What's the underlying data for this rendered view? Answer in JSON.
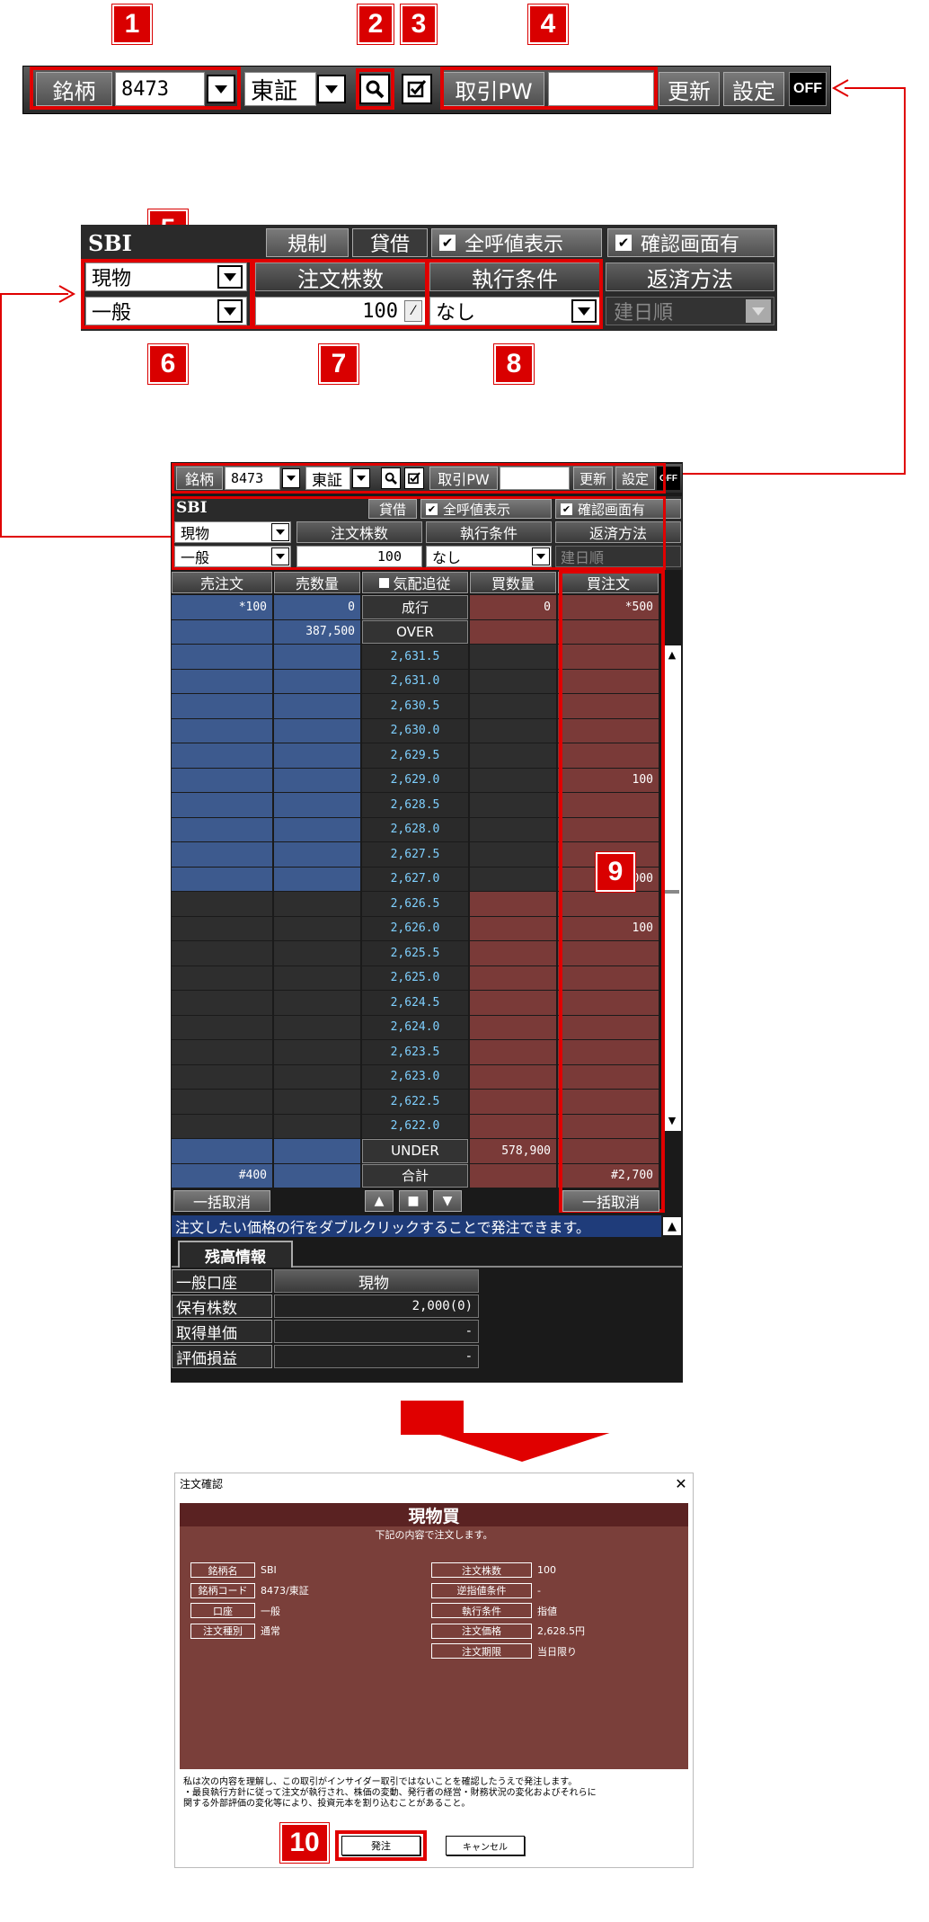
{
  "badges": [
    "1",
    "2",
    "3",
    "4",
    "5",
    "6",
    "7",
    "8",
    "9",
    "10"
  ],
  "toolbar": {
    "symbol_label": "銘柄",
    "symbol_value": "8473",
    "market_value": "東証",
    "search_icon": "search-icon",
    "check_icon": "checkbox-icon",
    "pw_label": "取引PW",
    "update_label": "更新",
    "settings_label": "設定",
    "off_label": "OFF"
  },
  "order_panel": {
    "name": "SBI",
    "rule_label": "規制",
    "lending_label": "貸借",
    "all_quotes_label": "全呼値表示",
    "confirm_label": "確認画面有",
    "account_type": "現物",
    "qty_header": "注文株数",
    "exec_header": "執行条件",
    "repay_header": "返済方法",
    "margin_type": "一般",
    "qty_value": "100",
    "exec_value": "なし",
    "repay_value": "建日順"
  },
  "board": {
    "headers": [
      "売注文",
      "売数量",
      "気配追従",
      "買数量",
      "買注文"
    ],
    "market_row": {
      "sell_order": "*100",
      "sell_qty": "0",
      "price": "成行",
      "buy_qty": "0",
      "buy_order": "*500"
    },
    "over_row": {
      "sell_qty": "387,500",
      "price": "OVER"
    },
    "rows": [
      {
        "price": "2,631.5",
        "buy_order": ""
      },
      {
        "price": "2,631.0",
        "buy_order": ""
      },
      {
        "price": "2,630.5",
        "buy_order": ""
      },
      {
        "price": "2,630.0",
        "buy_order": ""
      },
      {
        "price": "2,629.5",
        "buy_order": ""
      },
      {
        "price": "2,629.0",
        "buy_order": "100"
      },
      {
        "price": "2,628.5",
        "buy_order": ""
      },
      {
        "price": "2,628.0",
        "buy_order": ""
      },
      {
        "price": "2,627.5",
        "buy_order": ""
      },
      {
        "price": "2,627.0",
        "buy_order": "000"
      },
      {
        "price": "2,626.5",
        "buy_order": ""
      },
      {
        "price": "2,626.0",
        "buy_order": "100"
      },
      {
        "price": "2,625.5",
        "buy_order": ""
      },
      {
        "price": "2,625.0",
        "buy_order": ""
      },
      {
        "price": "2,624.5",
        "buy_order": ""
      },
      {
        "price": "2,624.0",
        "buy_order": ""
      },
      {
        "price": "2,623.5",
        "buy_order": ""
      },
      {
        "price": "2,623.0",
        "buy_order": ""
      },
      {
        "price": "2,622.5",
        "buy_order": ""
      },
      {
        "price": "2,622.0",
        "buy_order": ""
      }
    ],
    "under_row": {
      "price": "UNDER",
      "buy_qty": "578,900"
    },
    "total_row": {
      "sell_order": "#400",
      "price": "合計",
      "buy_order": "#2,700"
    },
    "cancel_all_label": "一括取消",
    "hint_text": "注文したい価格の行をダブルクリックすることで発注できます。"
  },
  "holdings": {
    "tab_label": "残高情報",
    "rows": [
      {
        "label": "一般口座",
        "value": "現物"
      },
      {
        "label": "保有株数",
        "value": "2,000(0)"
      },
      {
        "label": "取得単価",
        "value": "-"
      },
      {
        "label": "評価損益",
        "value": "-"
      }
    ]
  },
  "dialog": {
    "window_title": "注文確認",
    "close_icon": "close-icon",
    "heading": "現物買",
    "subheading": "下記の内容で注文します。",
    "left_fields": [
      {
        "label": "銘柄名",
        "value": "SBI"
      },
      {
        "label": "銘柄コード",
        "value": "8473/東証"
      },
      {
        "label": "口座",
        "value": "一般"
      },
      {
        "label": "注文種別",
        "value": "通常"
      }
    ],
    "right_fields": [
      {
        "label": "注文株数",
        "value": "100"
      },
      {
        "label": "逆指値条件",
        "value": "-"
      },
      {
        "label": "執行条件",
        "value": "指値"
      },
      {
        "label": "注文価格",
        "value": "2,628.5円"
      },
      {
        "label": "注文期限",
        "value": "当日限り"
      }
    ],
    "disclaimer_1": "私は次の内容を理解し、この取引がインサイダー取引ではないことを確認したうえで発注します。",
    "disclaimer_2": "・最良執行方針に従って注文が執行され、株価の変動、発行者の経営・財務状況の変化およびそれらに",
    "disclaimer_3": "関する外部評価の変化等により、投資元本を割り込むことがあること。",
    "submit_label": "発注",
    "cancel_label": "キャンセル"
  }
}
